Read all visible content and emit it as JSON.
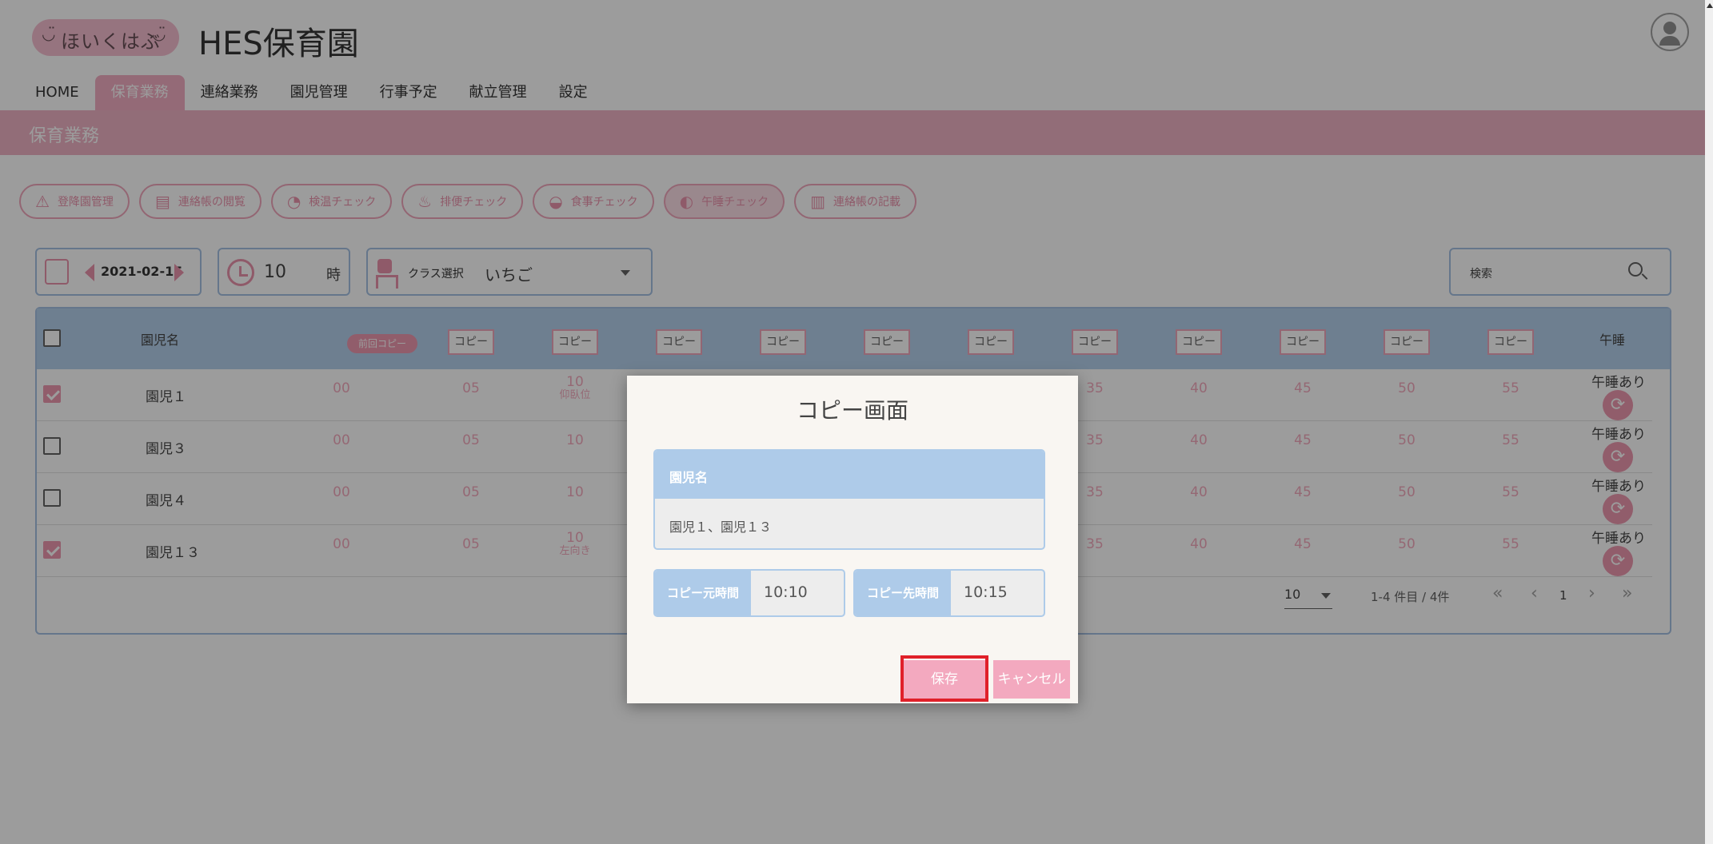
{
  "header": {
    "logo_text": "ほいくはぶ",
    "logo_face": "◡̈",
    "title": "HES保育園"
  },
  "nav": {
    "items": [
      {
        "label": "HOME"
      },
      {
        "label": "保育業務"
      },
      {
        "label": "連絡業務"
      },
      {
        "label": "園児管理"
      },
      {
        "label": "行事予定"
      },
      {
        "label": "献立管理"
      },
      {
        "label": "設定"
      }
    ]
  },
  "subbar": {
    "title": "保育業務"
  },
  "functions": [
    {
      "label": "登降園管理",
      "icon": "⚠"
    },
    {
      "label": "連絡帳の閲覧",
      "icon": "▤"
    },
    {
      "label": "検温チェック",
      "icon": "◔"
    },
    {
      "label": "排便チェック",
      "icon": "♨"
    },
    {
      "label": "食事チェック",
      "icon": "◒"
    },
    {
      "label": "午睡チェック",
      "icon": "◐"
    },
    {
      "label": "連絡帳の記載",
      "icon": "▥"
    }
  ],
  "controls": {
    "date": "2021-02-15",
    "hour": "10",
    "hour_unit": "時",
    "class_label": "クラス選択",
    "class_value": "いちご",
    "search_label": "検索"
  },
  "table": {
    "header_name": "園児名",
    "prev_copy": "前回コピー",
    "copy_label": "コピー",
    "nap_header": "午睡",
    "rows": [
      {
        "checked": true,
        "name": "園児１",
        "m00": "00",
        "m05": "05",
        "m10": "10",
        "m10_sub": "仰臥位",
        "m35": "35",
        "m40": "40",
        "m45": "45",
        "m50": "50",
        "m55": "55",
        "nap": "午睡あり"
      },
      {
        "checked": false,
        "name": "園児３",
        "m00": "00",
        "m05": "05",
        "m10": "10",
        "m10_sub": "",
        "m35": "35",
        "m40": "40",
        "m45": "45",
        "m50": "50",
        "m55": "55",
        "nap": "午睡あり"
      },
      {
        "checked": false,
        "name": "園児４",
        "m00": "00",
        "m05": "05",
        "m10": "10",
        "m10_sub": "",
        "m35": "35",
        "m40": "40",
        "m45": "45",
        "m50": "50",
        "m55": "55",
        "nap": "午睡あり"
      },
      {
        "checked": true,
        "name": "園児１３",
        "m00": "00",
        "m05": "05",
        "m10": "10",
        "m10_sub": "左向き",
        "m35": "35",
        "m40": "40",
        "m45": "45",
        "m50": "50",
        "m55": "55",
        "nap": "午睡あり"
      }
    ],
    "pager": {
      "page_size": "10",
      "range": "1-4 件目 / 4件",
      "first": "«",
      "prev": "‹",
      "page": "1",
      "next": "›",
      "last": "»"
    }
  },
  "dialog": {
    "title": "コピー画面",
    "names_label": "園児名",
    "names_value": "園児１、園児１３",
    "source_label": "コピー元時間",
    "source_value": "10:10",
    "target_label": "コピー先時間",
    "target_value": "10:15",
    "save_label": "保存",
    "cancel_label": "キャンセル"
  },
  "colors": {
    "accent_pink": "#f3a9bf",
    "header_blue": "#aecbe9",
    "highlight_red": "#e0202a"
  }
}
